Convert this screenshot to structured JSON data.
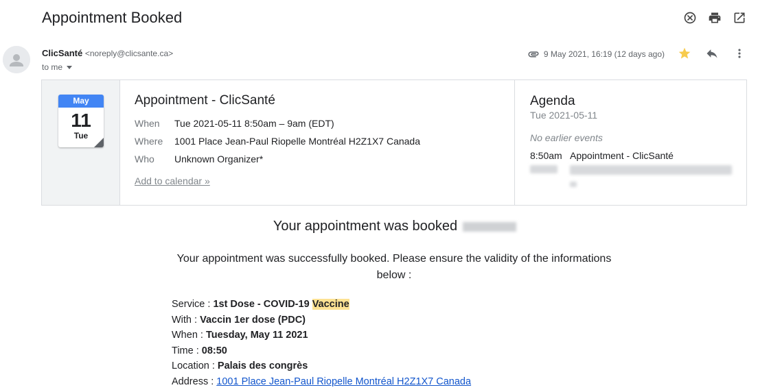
{
  "subject": "Appointment Booked",
  "sender": {
    "name": "ClicSanté",
    "email": "<noreply@clicsante.ca>",
    "to": "to me"
  },
  "meta": {
    "date": "9 May 2021, 16:19 (12 days ago)"
  },
  "icons": {
    "close": "close-circle-icon",
    "print": "print-icon",
    "popout": "open-in-new-window-icon",
    "attachment": "attachment-icon",
    "star": "star-icon",
    "reply": "reply-icon",
    "more": "more-vert-icon"
  },
  "invite": {
    "cal_month": "May",
    "cal_day": "11",
    "cal_dow": "Tue",
    "title": "Appointment - ClicSanté",
    "rows": [
      {
        "label": "When",
        "value": "Tue 2021-05-11 8:50am – 9am (EDT)"
      },
      {
        "label": "Where",
        "value": "1001 Place Jean-Paul Riopelle Montréal H2Z1X7 Canada"
      },
      {
        "label": "Who",
        "value": "Unknown Organizer*"
      }
    ],
    "add_to_calendar": "Add to calendar »"
  },
  "agenda": {
    "title": "Agenda",
    "date": "Tue 2021-05-11",
    "no_earlier": "No earlier events",
    "event_time": "8:50am",
    "event_name": "Appointment - ClicSanté"
  },
  "body": {
    "headline": "Your appointment was booked",
    "intro": "Your appointment was successfully booked. Please ensure the validity of the informations below :",
    "service_label": "Service : ",
    "service_value": "1st Dose - COVID-19 ",
    "service_highlight": "Vaccine",
    "with_label": "With : ",
    "with_value": "Vaccin 1er dose (PDC)",
    "when_label": "When : ",
    "when_value": "Tuesday, May 11 2021",
    "time_label": "Time : ",
    "time_value": "08:50",
    "location_label": "Location : ",
    "location_value": "Palais des congrès",
    "address_label": "Address : ",
    "address_value": "1001 Place Jean-Paul Riopelle Montréal H2Z1X7 Canada"
  },
  "colors": {
    "accent_blue": "#4285f4",
    "star": "#f7cb4d",
    "highlight": "#fde293",
    "link": "#1155cc"
  }
}
